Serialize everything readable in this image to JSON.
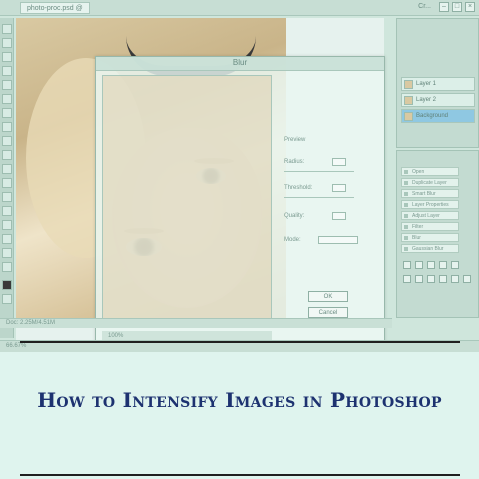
{
  "app": {
    "window_tab": "photo-proc.psd @",
    "title_right": "Cr..."
  },
  "dialog": {
    "title": "Blur",
    "options": [
      {
        "label": "Preview"
      },
      {
        "label": "Radius:"
      },
      {
        "label": "Threshold:"
      },
      {
        "label": "Quality:"
      },
      {
        "label": "Mode:"
      }
    ],
    "buttons": [
      "OK",
      "Cancel"
    ],
    "status": "100%"
  },
  "layers": {
    "items": [
      "Layer 1",
      "Layer 2",
      "Background"
    ]
  },
  "history": {
    "items": [
      "Open",
      "Duplicate Layer",
      "Smart Blur",
      "Layer Properties",
      "Adjust Layer",
      "Filter",
      "Blur",
      "Gaussian Blur"
    ]
  },
  "statusbar": {
    "zoom": "66.67%",
    "doc_info": "Doc: 2.25M/4.51M"
  },
  "headline": "How to Intensify Images in Photoshop",
  "colors": {
    "headline": "#1d3270",
    "background": "#dff4ee",
    "rule": "#1f1f1f"
  }
}
